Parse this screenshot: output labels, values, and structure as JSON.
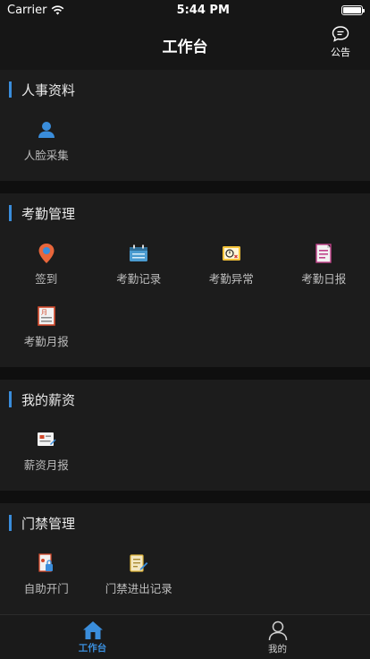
{
  "status": {
    "carrier": "Carrier",
    "time": "5:44 PM"
  },
  "nav": {
    "title": "工作台",
    "notice_label": "公告"
  },
  "sections": [
    {
      "title": "人事资料",
      "items": [
        {
          "label": "人脸采集",
          "icon": "face-capture-icon"
        }
      ]
    },
    {
      "title": "考勤管理",
      "items": [
        {
          "label": "签到",
          "icon": "location-pin-icon"
        },
        {
          "label": "考勤记录",
          "icon": "calendar-icon"
        },
        {
          "label": "考勤异常",
          "icon": "attendance-exception-icon"
        },
        {
          "label": "考勤日报",
          "icon": "daily-report-icon"
        },
        {
          "label": "考勤月报",
          "icon": "monthly-report-icon"
        }
      ]
    },
    {
      "title": "我的薪资",
      "items": [
        {
          "label": "薪资月报",
          "icon": "salary-report-icon"
        }
      ]
    },
    {
      "title": "门禁管理",
      "items": [
        {
          "label": "自助开门",
          "icon": "self-open-door-icon"
        },
        {
          "label": "门禁进出记录",
          "icon": "access-record-icon"
        }
      ]
    }
  ],
  "tabs": [
    {
      "label": "工作台",
      "icon": "home-icon"
    },
    {
      "label": "我的",
      "icon": "user-icon"
    }
  ],
  "colors": {
    "accent": "#3a8ddb",
    "background": "#0f0f0f",
    "card": "#1c1c1c"
  }
}
